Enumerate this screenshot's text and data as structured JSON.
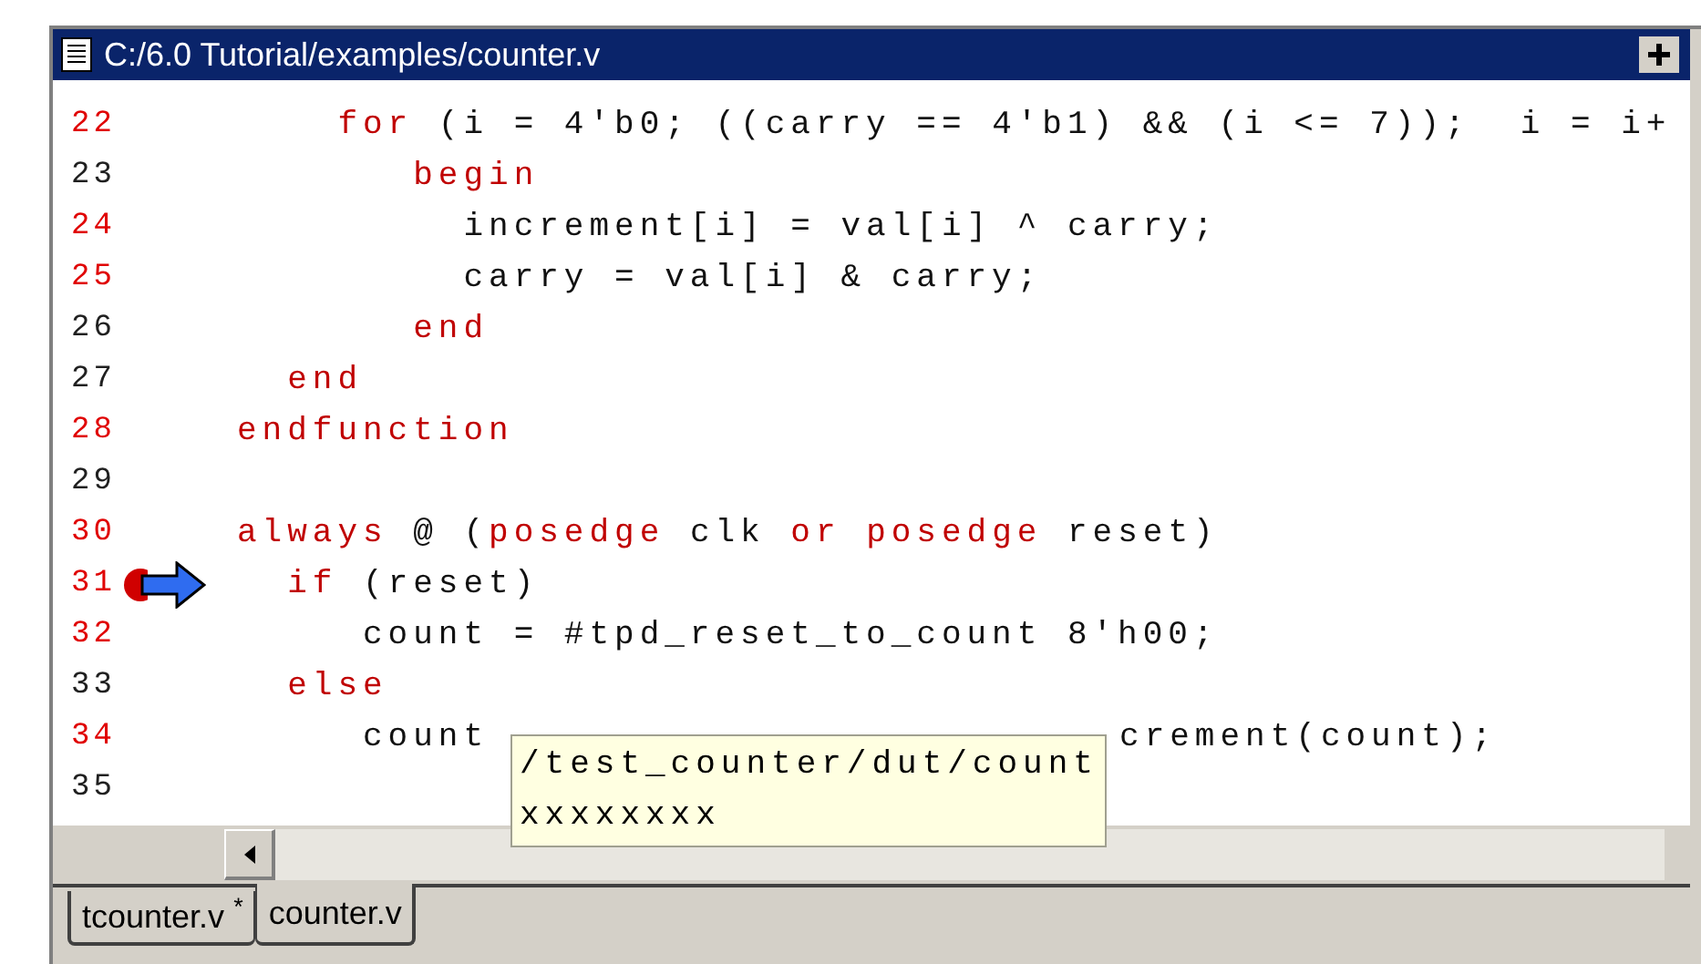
{
  "window": {
    "title": "C:/6.0 Tutorial/examples/counter.v"
  },
  "lines": [
    {
      "number": "22",
      "executable": true,
      "breakpoint": false,
      "current": false,
      "tokens": [
        {
          "kind": "keyword",
          "text": "    for"
        },
        {
          "kind": "plain",
          "text": " (i = 4'b0; ((carry == 4'b1) && (i <= 7));  i = i+"
        }
      ]
    },
    {
      "number": "23",
      "executable": false,
      "breakpoint": false,
      "current": false,
      "tokens": [
        {
          "kind": "keyword",
          "text": "       begin"
        }
      ]
    },
    {
      "number": "24",
      "executable": true,
      "breakpoint": false,
      "current": false,
      "tokens": [
        {
          "kind": "plain",
          "text": "         increment[i] = val[i] ^ carry;"
        }
      ]
    },
    {
      "number": "25",
      "executable": true,
      "breakpoint": false,
      "current": false,
      "tokens": [
        {
          "kind": "plain",
          "text": "         carry = val[i] & carry;"
        }
      ]
    },
    {
      "number": "26",
      "executable": false,
      "breakpoint": false,
      "current": false,
      "tokens": [
        {
          "kind": "keyword",
          "text": "       end"
        }
      ]
    },
    {
      "number": "27",
      "executable": false,
      "breakpoint": false,
      "current": false,
      "tokens": [
        {
          "kind": "keyword",
          "text": "  end"
        }
      ]
    },
    {
      "number": "28",
      "executable": true,
      "breakpoint": false,
      "current": false,
      "tokens": [
        {
          "kind": "keyword",
          "text": "endfunction"
        }
      ]
    },
    {
      "number": "29",
      "executable": false,
      "breakpoint": false,
      "current": false
    },
    {
      "number": "30",
      "executable": true,
      "breakpoint": false,
      "current": false,
      "tokens": [
        {
          "kind": "keyword",
          "text": "always"
        },
        {
          "kind": "plain",
          "text": " @ ("
        },
        {
          "kind": "keyword",
          "text": "posedge"
        },
        {
          "kind": "plain",
          "text": " clk "
        },
        {
          "kind": "keyword",
          "text": "or posedge"
        },
        {
          "kind": "plain",
          "text": " reset)"
        }
      ]
    },
    {
      "number": "31",
      "executable": true,
      "breakpoint": true,
      "current": true,
      "tokens": [
        {
          "kind": "keyword",
          "text": "  if"
        },
        {
          "kind": "plain",
          "text": " (reset)"
        }
      ]
    },
    {
      "number": "32",
      "executable": true,
      "breakpoint": false,
      "current": false,
      "tokens": [
        {
          "kind": "plain",
          "text": "     count = #tpd_reset_to_count 8'h00;"
        }
      ]
    },
    {
      "number": "33",
      "executable": false,
      "breakpoint": false,
      "current": false,
      "tokens": [
        {
          "kind": "keyword",
          "text": "  else"
        }
      ]
    },
    {
      "number": "34",
      "executable": true,
      "breakpoint": false,
      "current": false,
      "tokens": [
        {
          "kind": "plain",
          "text": "     count"
        },
        {
          "kind": "plain",
          "text": "crement(count);",
          "after_hidden_gap": true
        }
      ]
    },
    {
      "number": "35",
      "executable": false,
      "breakpoint": false,
      "current": false
    }
  ],
  "tooltip": {
    "path": "/test_counter/dut/count",
    "value": "xxxxxxxx"
  },
  "tabs": [
    {
      "label": "tcounter.v $^{*}$",
      "selected": false
    },
    {
      "label": "counter.v",
      "selected": true
    }
  ]
}
